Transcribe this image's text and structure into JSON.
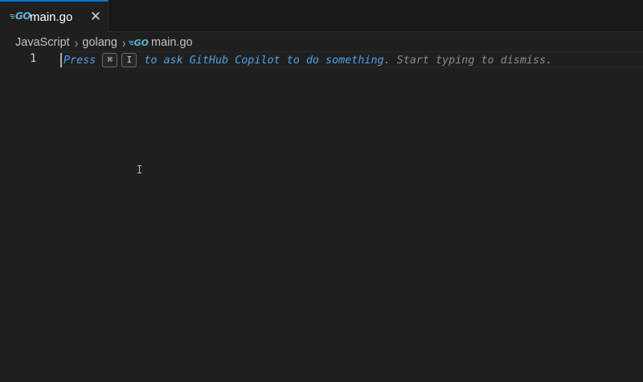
{
  "tabs": [
    {
      "icon": "go-file-icon",
      "icon_text": "GO",
      "label": "main.go",
      "close_glyph": "✕",
      "active": true
    }
  ],
  "breadcrumb": {
    "items": [
      "JavaScript",
      "golang"
    ],
    "file_icon_text": "GO",
    "file_label": "main.go",
    "separator": "›"
  },
  "editor": {
    "line_number": "1",
    "hint_press": "Press",
    "hint_key_1": "⌘",
    "hint_key_2": "I",
    "hint_action": "to ask GitHub Copilot to do something.",
    "hint_dismiss": "Start typing to dismiss."
  },
  "colors": {
    "background": "#1f1f1f",
    "tab_accent": "#0078d4",
    "go_icon": "#5fb4d6",
    "hint_blue": "#4fa3e8",
    "hint_gray": "#8b8b8b"
  }
}
